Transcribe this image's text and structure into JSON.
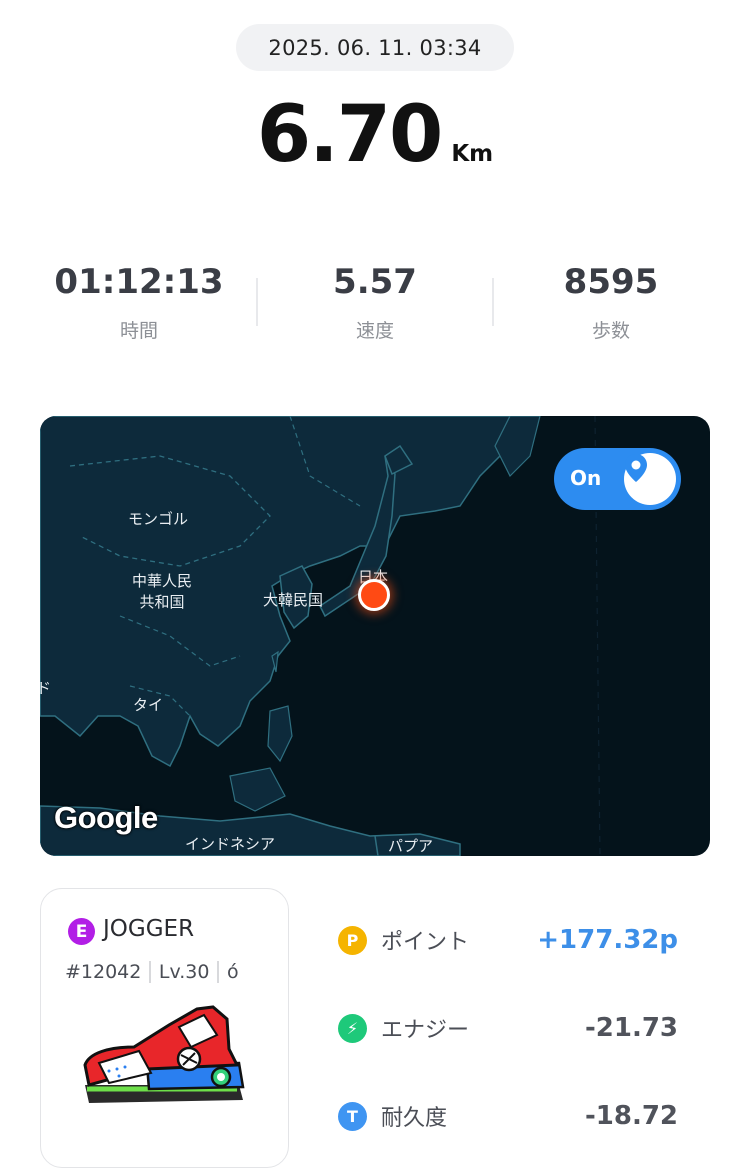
{
  "header": {
    "datetime": "2025. 06. 11. 03:34"
  },
  "distance": {
    "value": "6.70",
    "unit": "Km"
  },
  "stats": [
    {
      "value": "01:12:13",
      "label": "時間"
    },
    {
      "value": "5.57",
      "label": "速度"
    },
    {
      "value": "8595",
      "label": "歩数"
    }
  ],
  "map": {
    "labels": {
      "mongolia": "モンゴル",
      "china": "中華人民\n共和国",
      "korea": "大韓民国",
      "japan": "日本",
      "thailand": "タイ",
      "indonesia": "インドネシア",
      "papua": "パプア",
      "edge": "ド"
    },
    "attribution": "Google",
    "toggle": {
      "label": "On",
      "icon": "location-pin-icon"
    }
  },
  "sneaker": {
    "badge": "E",
    "name": "JOGGER",
    "id": "#12042",
    "level": "Lv.30",
    "extra": "ó"
  },
  "rewards": [
    {
      "icon": "P",
      "icon_name": "point-coin-icon",
      "label": "ポイント",
      "value": "+177.32p",
      "color": "#f5b400",
      "value_color": "#3d8fe8"
    },
    {
      "icon": "⚡",
      "icon_name": "energy-bolt-icon",
      "label": "エナジー",
      "value": "-21.73",
      "color": "#1ec97a",
      "value_color": "#50535b"
    },
    {
      "icon": "T",
      "icon_name": "durability-icon",
      "label": "耐久度",
      "value": "-18.72",
      "color": "#3f95f2",
      "value_color": "#50535b"
    }
  ]
}
